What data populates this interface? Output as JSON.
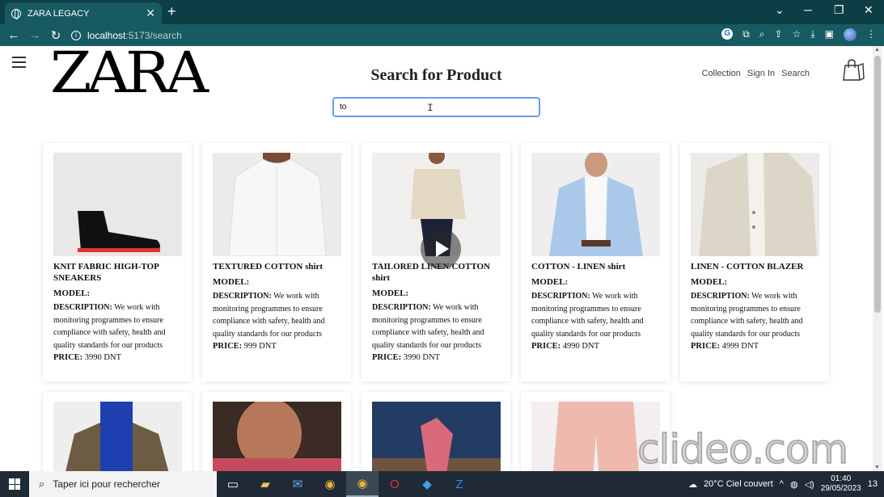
{
  "browser": {
    "tab_title": "ZARA LEGACY",
    "tab_close": "✕",
    "new_tab": "+",
    "url_host": "localhost",
    "url_path": ":5173/search",
    "win_min": "─",
    "win_restore": "❐",
    "win_close": "✕",
    "win_chevron": "⌄",
    "back": "←",
    "forward": "→",
    "reload": "↻",
    "ext_g": "G"
  },
  "header": {
    "logo": "ZARA",
    "heading": "Search for Product",
    "nav": [
      "Collection",
      "Sign In",
      "Search"
    ]
  },
  "search": {
    "value": "to"
  },
  "products": [
    {
      "name": "KNIT FABRIC HIGH-TOP SNEAKERS",
      "model_label": "MODEL:",
      "desc_label": "DESCRIPTION:",
      "desc": "We work with monitoring programmes to ensure compliance with safety, health and quality standards for our products",
      "price_label": "PRICE:",
      "price": "3990 DNT",
      "image": "sneaker"
    },
    {
      "name": "TEXTURED COTTON shirt",
      "model_label": "MODEL:",
      "desc_label": "DESCRIPTION:",
      "desc": "We work with monitoring programmes to ensure compliance with safety, health and quality standards for our products",
      "price_label": "PRICE:",
      "price": "999 DNT",
      "image": "white-shirt"
    },
    {
      "name": "TAILORED LINEN/COTTON shirt",
      "model_label": "MODEL:",
      "desc_label": "DESCRIPTION:",
      "desc": "We work with monitoring programmes to ensure compliance with safety, health and quality standards for our products",
      "price_label": "PRICE:",
      "price": "3990 DNT",
      "image": "beige-shirt"
    },
    {
      "name": "COTTON - LINEN shirt",
      "model_label": "MODEL:",
      "desc_label": "DESCRIPTION:",
      "desc": "We work with monitoring programmes to ensure compliance with safety, health and quality standards for our products",
      "price_label": "PRICE:",
      "price": "4990 DNT",
      "image": "blue-blazer"
    },
    {
      "name": "LINEN - COTTON BLAZER",
      "model_label": "MODEL:",
      "desc_label": "DESCRIPTION:",
      "desc": "We work with monitoring programmes to ensure compliance with safety, health and quality standards for our products",
      "price_label": "PRICE:",
      "price": "4999 DNT",
      "image": "linen-blazer"
    }
  ],
  "colors": {
    "chrome_dark": "#0e3e45",
    "chrome": "#175a62",
    "search_focus": "#6b9cf0",
    "taskbar": "#1f2a36"
  },
  "watermark": "clideo.com",
  "taskbar": {
    "search_placeholder": "Taper ici pour rechercher",
    "weather": "20°C  Ciel couvert",
    "time": "01:40",
    "date": "29/05/2023",
    "notifications": "13"
  }
}
